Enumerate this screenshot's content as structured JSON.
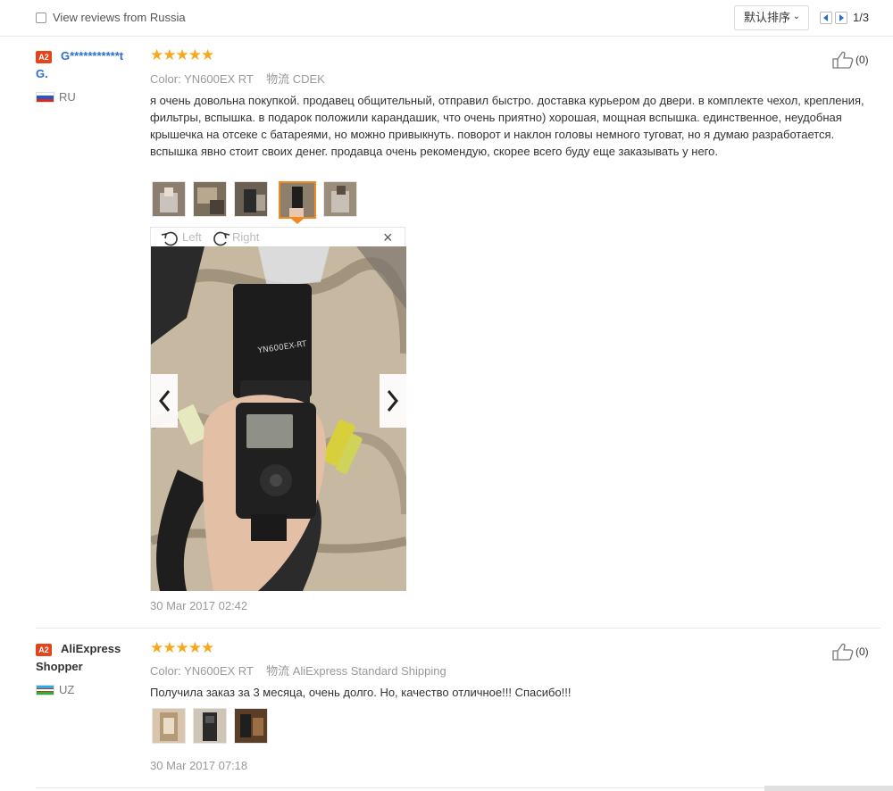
{
  "topbar": {
    "filter_label": "View reviews from Russia",
    "sort_label": "默认排序",
    "page_indicator": "1/3"
  },
  "reviews": [
    {
      "badge": "A2",
      "user_name_line1": "G***********t",
      "user_name_line2": "G.",
      "country": "RU",
      "stars": "★★★★★",
      "color_label": "Color:",
      "color_value": "YN600EX RT",
      "shipping_label": "物流",
      "shipping_value": "CDEK",
      "likes": "(0)",
      "text": "я очень довольна покупкой. продавец общительный, отправил быстро. доставка курьером до двери. в комплекте чехол, крепления, фильтры, вспышка. в подарок положили карандашик, что очень приятно) хорошая, мощная вспышка. единственное, неудобная крышечка на отсеке с батареями, но можно привыкнуть. поворот и наклон головы немного туговат, но я думаю разработается. вспышка явно стоит своих денег. продавца очень рекомендую, скорее всего буду еще заказывать у него.",
      "date": "30 Mar 2017 02:42",
      "viewer": {
        "left_label": "Left",
        "right_label": "Right",
        "close": "×"
      }
    },
    {
      "badge": "A2",
      "user_name_line1": "AliExpress",
      "user_name_line2": "Shopper",
      "country": "UZ",
      "stars": "★★★★★",
      "color_label": "Color:",
      "color_value": "YN600EX RT",
      "shipping_label": "物流",
      "shipping_value": "AliExpress Standard Shipping",
      "likes": "(0)",
      "text": "Получила заказ за 3 месяца, очень долго. Но, качество отличное!!! Спасибо!!!",
      "date": "30 Mar 2017 07:18"
    }
  ]
}
